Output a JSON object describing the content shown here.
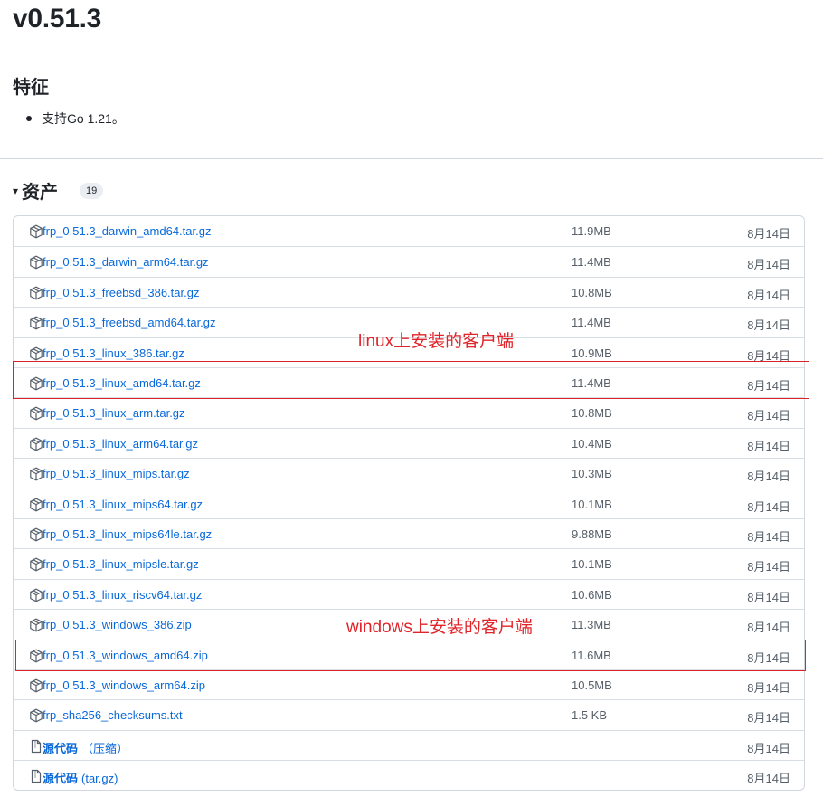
{
  "release": {
    "version": "v0.51.3",
    "features_heading": "特征",
    "features": [
      "支持Go 1.21。"
    ]
  },
  "assets": {
    "caret": "▾",
    "heading": "资产",
    "count": "19",
    "items": [
      {
        "name": "frp_0.51.3_darwin_amd64.tar.gz",
        "size": "11.9MB",
        "date": "8月14日",
        "icon": "package-icon"
      },
      {
        "name": "frp_0.51.3_darwin_arm64.tar.gz",
        "size": "11.4MB",
        "date": "8月14日",
        "icon": "package-icon"
      },
      {
        "name": "frp_0.51.3_freebsd_386.tar.gz",
        "size": "10.8MB",
        "date": "8月14日",
        "icon": "package-icon"
      },
      {
        "name": "frp_0.51.3_freebsd_amd64.tar.gz",
        "size": "11.4MB",
        "date": "8月14日",
        "icon": "package-icon"
      },
      {
        "name": "frp_0.51.3_linux_386.tar.gz",
        "size": "10.9MB",
        "date": "8月14日",
        "icon": "package-icon"
      },
      {
        "name": "frp_0.51.3_linux_amd64.tar.gz",
        "size": "11.4MB",
        "date": "8月14日",
        "icon": "package-icon"
      },
      {
        "name": "frp_0.51.3_linux_arm.tar.gz",
        "size": "10.8MB",
        "date": "8月14日",
        "icon": "package-icon"
      },
      {
        "name": "frp_0.51.3_linux_arm64.tar.gz",
        "size": "10.4MB",
        "date": "8月14日",
        "icon": "package-icon"
      },
      {
        "name": "frp_0.51.3_linux_mips.tar.gz",
        "size": "10.3MB",
        "date": "8月14日",
        "icon": "package-icon"
      },
      {
        "name": "frp_0.51.3_linux_mips64.tar.gz",
        "size": "10.1MB",
        "date": "8月14日",
        "icon": "package-icon"
      },
      {
        "name": "frp_0.51.3_linux_mips64le.tar.gz",
        "size": "9.88MB",
        "date": "8月14日",
        "icon": "package-icon"
      },
      {
        "name": "frp_0.51.3_linux_mipsle.tar.gz",
        "size": "10.1MB",
        "date": "8月14日",
        "icon": "package-icon"
      },
      {
        "name": "frp_0.51.3_linux_riscv64.tar.gz",
        "size": "10.6MB",
        "date": "8月14日",
        "icon": "package-icon"
      },
      {
        "name": "frp_0.51.3_windows_386.zip",
        "size": "11.3MB",
        "date": "8月14日",
        "icon": "package-icon"
      },
      {
        "name": "frp_0.51.3_windows_amd64.zip",
        "size": "11.6MB",
        "date": "8月14日",
        "icon": "package-icon"
      },
      {
        "name": "frp_0.51.3_windows_arm64.zip",
        "size": "10.5MB",
        "date": "8月14日",
        "icon": "package-icon"
      },
      {
        "name": "frp_sha256_checksums.txt",
        "size": "1.5 KB",
        "date": "8月14日",
        "icon": "package-icon"
      },
      {
        "name": "源代码",
        "suffix": "（压缩）",
        "size": "",
        "date": "8月14日",
        "icon": "file-zip-icon"
      },
      {
        "name": "源代码",
        "suffix": "(tar.gz)",
        "size": "",
        "date": "8月14日",
        "icon": "file-zip-icon"
      }
    ]
  },
  "annotations": {
    "linux_note": "linux上安装的客户端",
    "windows_note": "windows上安装的客户端",
    "color": "#e0242a"
  },
  "colors": {
    "link": "#0969da",
    "muted": "#57606a",
    "border": "#d0d7de"
  }
}
